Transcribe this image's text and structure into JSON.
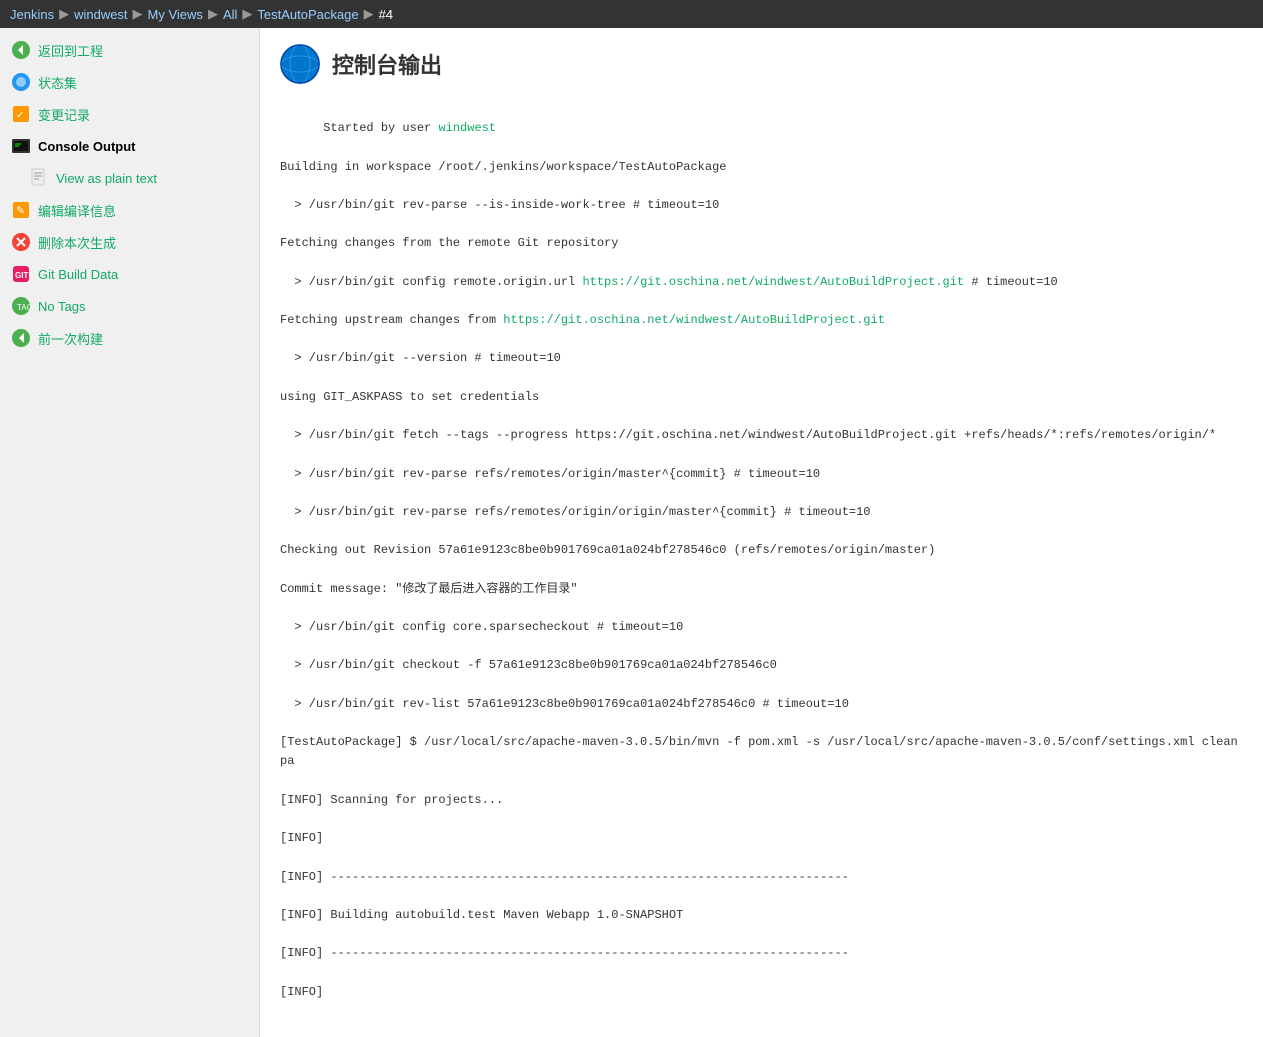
{
  "topbar": {
    "items": [
      {
        "label": "Jenkins",
        "link": true
      },
      {
        "label": "windwest",
        "link": true
      },
      {
        "label": "My Views",
        "link": true
      },
      {
        "label": "All",
        "link": true
      },
      {
        "label": "TestAutoPackage",
        "link": true
      },
      {
        "label": "#4",
        "link": false
      }
    ],
    "separators": [
      "▶",
      "▶",
      "▶",
      "▶",
      "▶"
    ]
  },
  "sidebar": {
    "items": [
      {
        "id": "back",
        "label": "返回到工程",
        "icon": "back-icon",
        "indent": false
      },
      {
        "id": "status",
        "label": "状态集",
        "icon": "status-icon",
        "indent": false
      },
      {
        "id": "changes",
        "label": "变更记录",
        "icon": "changes-icon",
        "indent": false
      },
      {
        "id": "console",
        "label": "Console Output",
        "icon": "console-icon",
        "indent": false,
        "active": true
      },
      {
        "id": "plain",
        "label": "View as plain text",
        "icon": "plain-icon",
        "indent": true
      },
      {
        "id": "edit",
        "label": "编辑编译信息",
        "icon": "edit-icon",
        "indent": false
      },
      {
        "id": "delete",
        "label": "删除本次生成",
        "icon": "delete-icon",
        "indent": false
      },
      {
        "id": "git",
        "label": "Git Build Data",
        "icon": "git-icon",
        "indent": false
      },
      {
        "id": "notag",
        "label": "No Tags",
        "icon": "notag-icon",
        "indent": false
      },
      {
        "id": "prev",
        "label": "前一次构建",
        "icon": "prev-icon",
        "indent": false
      }
    ]
  },
  "content": {
    "title": "控制台输出",
    "console_lines": [
      "Started by user windwest",
      "Building in workspace /root/.jenkins/workspace/TestAutoPackage",
      "  > /usr/bin/git rev-parse --is-inside-work-tree # timeout=10",
      "Fetching changes from the remote Git repository",
      "  > /usr/bin/git config remote.origin.url https://git.oschina.net/windwest/AutoBuildProject.git # timeout=10",
      "Fetching upstream changes from https://git.oschina.net/windwest/AutoBuildProject.git",
      "  > /usr/bin/git --version # timeout=10",
      "using GIT_ASKPASS to set credentials",
      "  > /usr/bin/git fetch --tags --progress https://git.oschina.net/windwest/AutoBuildProject.git +refs/heads/*:refs/remotes/origin/*",
      "  > /usr/bin/git rev-parse refs/remotes/origin/master^{commit} # timeout=10",
      "  > /usr/bin/git rev-parse refs/remotes/origin/origin/master^{commit} # timeout=10",
      "Checking out Revision 57a61e9123c8be0b901769ca01a024bf278546c0 (refs/remotes/origin/master)",
      "Commit message: \"修改了最后进入容器的工作目录\"",
      "  > /usr/bin/git config core.sparsecheckout # timeout=10",
      "  > /usr/bin/git checkout -f 57a61e9123c8be0b901769ca01a024bf278546c0",
      "  > /usr/bin/git rev-list 57a61e9123c8be0b901769ca01a024bf278546c0 # timeout=10",
      "[TestAutoPackage] $ /usr/local/src/apache-maven-3.0.5/bin/mvn -f pom.xml -s /usr/local/src/apache-maven-3.0.5/conf/settings.xml clean pa",
      "[INFO] Scanning for projects...",
      "[INFO]",
      "[INFO] ------------------------------------------------------------------------",
      "[INFO] Building autobuild.test Maven Webapp 1.0-SNAPSHOT",
      "[INFO] ------------------------------------------------------------------------",
      "[INFO]"
    ],
    "links": {
      "windwest": "windwest",
      "url1": "https://git.oschina.net/windwest/AutoBuildProject.git",
      "url2": "https://git.oschina.net/windwest/AutoBuildProject.git"
    }
  }
}
